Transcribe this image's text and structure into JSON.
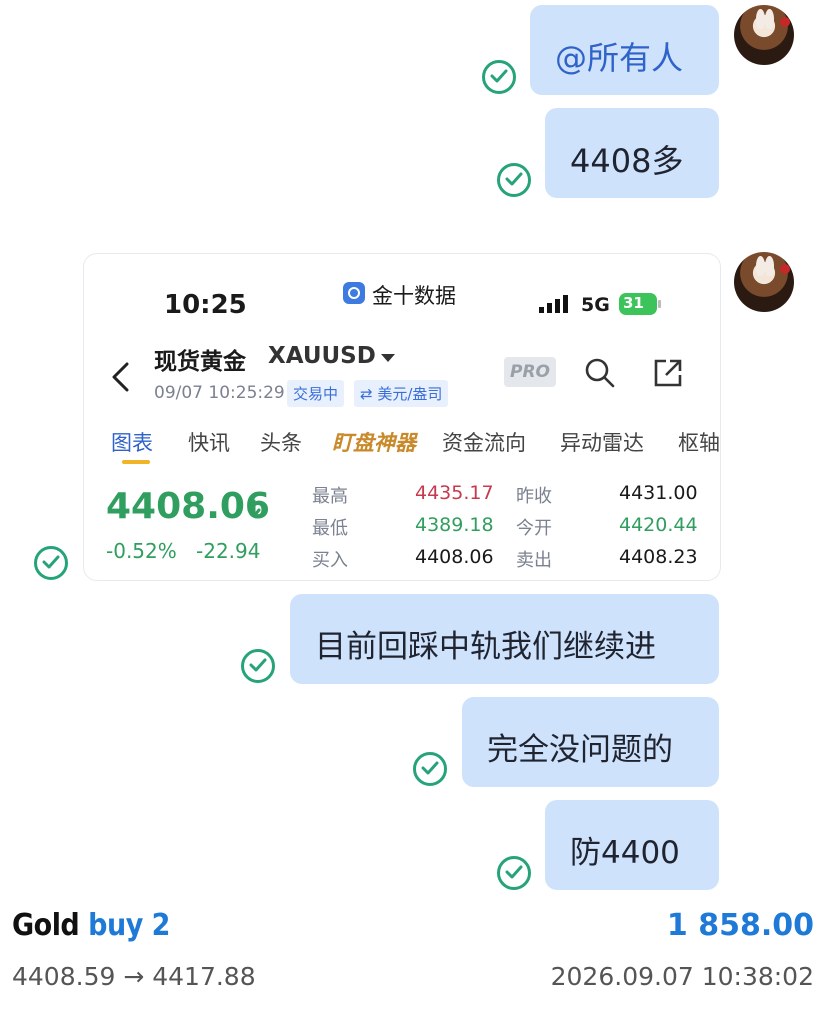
{
  "chat": {
    "messages": [
      {
        "text": "@所有人"
      },
      {
        "text": "4408多"
      },
      {
        "text": "目前回踩中轨我们继续进"
      },
      {
        "text": "完全没问题的"
      },
      {
        "text": "防4400"
      }
    ]
  },
  "screenshot": {
    "status_time": "10:25",
    "app_name": "金十数据",
    "network": "5G",
    "battery": "31",
    "instrument_name": "现货黄金",
    "instrument_code": "XAUUSD",
    "timestamp": "09/07 10:25:29",
    "trading_status": "交易中",
    "currency_tag": "⇄ 美元/盎司",
    "pro_label": "PRO",
    "tabs": [
      "图表",
      "快讯",
      "头条",
      "盯盘神器",
      "资金流向",
      "异动雷达",
      "枢轴"
    ],
    "price": "4408.06",
    "change_pct": "-0.52%",
    "change_abs": "-22.94",
    "stats": {
      "high_label": "最高",
      "high_value": "4435.17",
      "low_label": "最低",
      "low_value": "4389.18",
      "bid_label": "买入",
      "bid_value": "4408.06",
      "prev_close_label": "昨收",
      "prev_close_value": "4431.00",
      "open_label": "今开",
      "open_value": "4420.44",
      "ask_label": "卖出",
      "ask_value": "4408.23"
    }
  },
  "footer": {
    "asset": "Gold",
    "action": "buy 2",
    "profit": "1 858.00",
    "price_range": "4408.59 → 4417.88",
    "datetime": "2026.09.07 10:38:02"
  },
  "colors": {
    "bubble": "#cfe2fb",
    "check": "#26a37a",
    "accent_blue": "#1e7ad6",
    "price_green": "#2f9e5e",
    "price_red": "#c8394c"
  },
  "icons": [
    "read-check-icon",
    "avatar",
    "back-arrow-icon",
    "search-icon",
    "share-icon",
    "down-arrow-icon",
    "dropdown-icon",
    "signal-icon",
    "app-logo-icon"
  ]
}
